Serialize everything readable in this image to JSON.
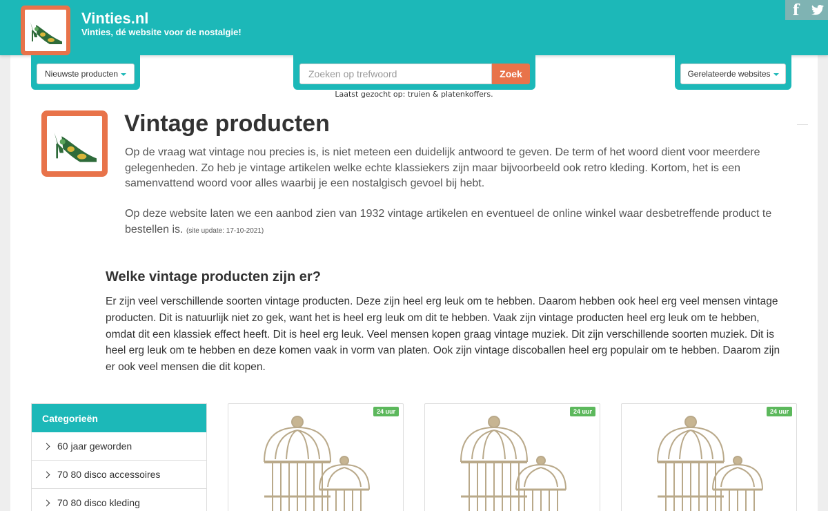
{
  "header": {
    "site_title": "Vinties.nl",
    "tagline": "Vinties, dé website voor de nostalgie!",
    "social": [
      "facebook-icon",
      "twitter-icon"
    ]
  },
  "nav": {
    "newest_label": "Nieuwste producten",
    "search_placeholder": "Zoeken op trefwoord",
    "search_button": "Zoek",
    "last_searched": "Laatst gezocht op: truien & platenkoffers.",
    "related_label": "Gerelateerde websites"
  },
  "intro": {
    "title": "Vintage producten",
    "paragraph1": "Op de vraag wat vintage nou precies is, is niet meteen een duidelijk antwoord te geven. De term of het woord dient voor meerdere gelegenheden. Zo heb je vintage artikelen welke echte klassiekers zijn maar bijvoorbeeld ook retro kleding. Kortom, het is een samenvattend woord voor alles waarbij je een nostalgisch gevoel bij hebt.",
    "paragraph2": "Op deze website laten we een aanbod zien van 1932 vintage artikelen en eventueel de online winkel waar desbetreffende product te bestellen is.",
    "site_update": "(site update: 17-10-2021)"
  },
  "article": {
    "heading": "Welke vintage producten zijn er?",
    "text": "Er zijn veel verschillende soorten vintage producten. Deze zijn heel erg leuk om te hebben. Daarom hebben ook heel erg veel mensen vintage producten. Dit is natuurlijk niet zo gek, want het is heel erg leuk om dit te hebben. Vaak zijn vintage producten heel erg leuk om te hebben, omdat dit een klassiek effect heeft. Dit is heel erg leuk. Veel mensen kopen graag vintage muziek. Dit zijn verschillende soorten muziek. Dit is heel erg leuk om te hebben en deze komen vaak in vorm van platen. Ook zijn vintage discoballen heel erg populair om te hebben. Daarom zijn er ook veel mensen die dit kopen."
  },
  "categories": {
    "title": "Categorieën",
    "items": [
      "60 jaar geworden",
      "70 80 disco accessoires",
      "70 80 disco kleding"
    ]
  },
  "products": [
    {
      "badge": "24 uur",
      "image": "bird-cage"
    },
    {
      "badge": "24 uur",
      "image": "bird-cage"
    },
    {
      "badge": "24 uur",
      "image": "bird-cage"
    }
  ],
  "colors": {
    "teal": "#1cb8b8",
    "orange": "#e8734a",
    "badge_green": "#5cb85c"
  }
}
